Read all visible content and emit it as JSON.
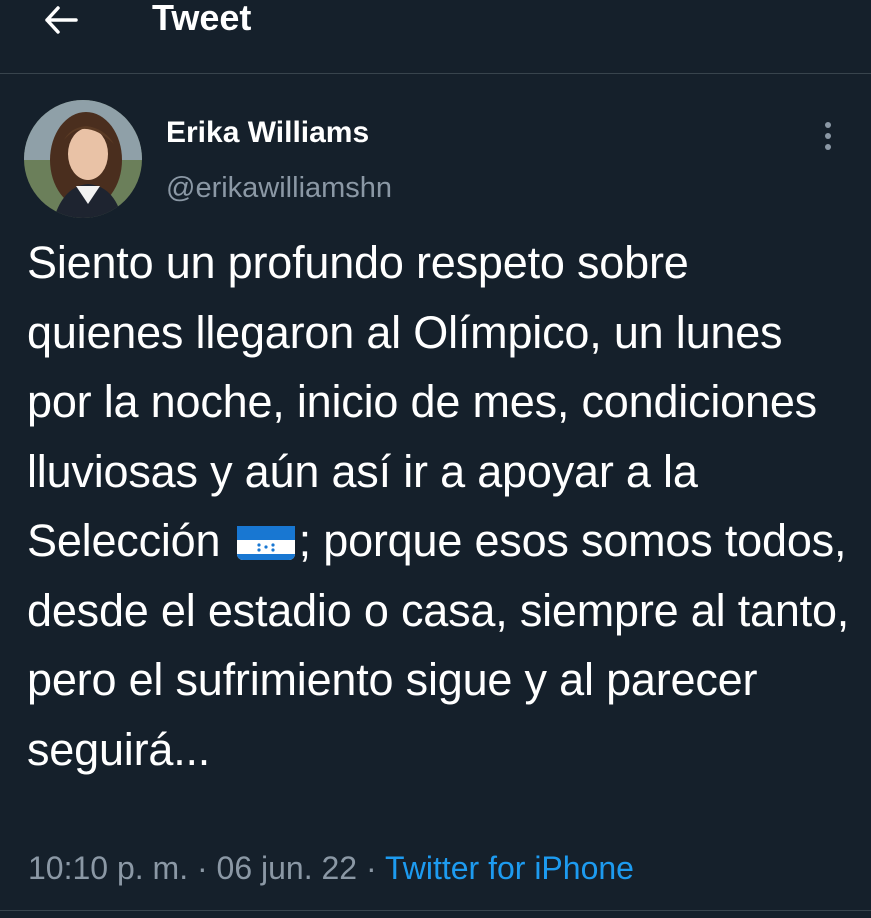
{
  "header": {
    "title": "Tweet",
    "back_icon": "arrow-left-icon"
  },
  "tweet": {
    "author_name": "Erika Williams",
    "author_handle": "@erikawilliamshn",
    "text_before_flag": "Siento un profundo respeto sobre quienes llegaron al Olímpico, un lunes por la noche, inicio de mes, condiciones lluviosas y aún así ir a apoyar a la Selección",
    "flag_emoji": "honduras-flag",
    "text_after_flag": "; porque esos somos todos, desde el estadio o casa, siempre al tanto, pero el sufrimiento sigue y al parecer seguirá...",
    "time": "10:10 p. m.",
    "separator": "·",
    "date": "06 jun. 22",
    "source": "Twitter for iPhone"
  },
  "colors": {
    "background": "#15202b",
    "secondary_text": "#8b98a5",
    "link": "#1d9bf0",
    "divider": "#38444d"
  }
}
